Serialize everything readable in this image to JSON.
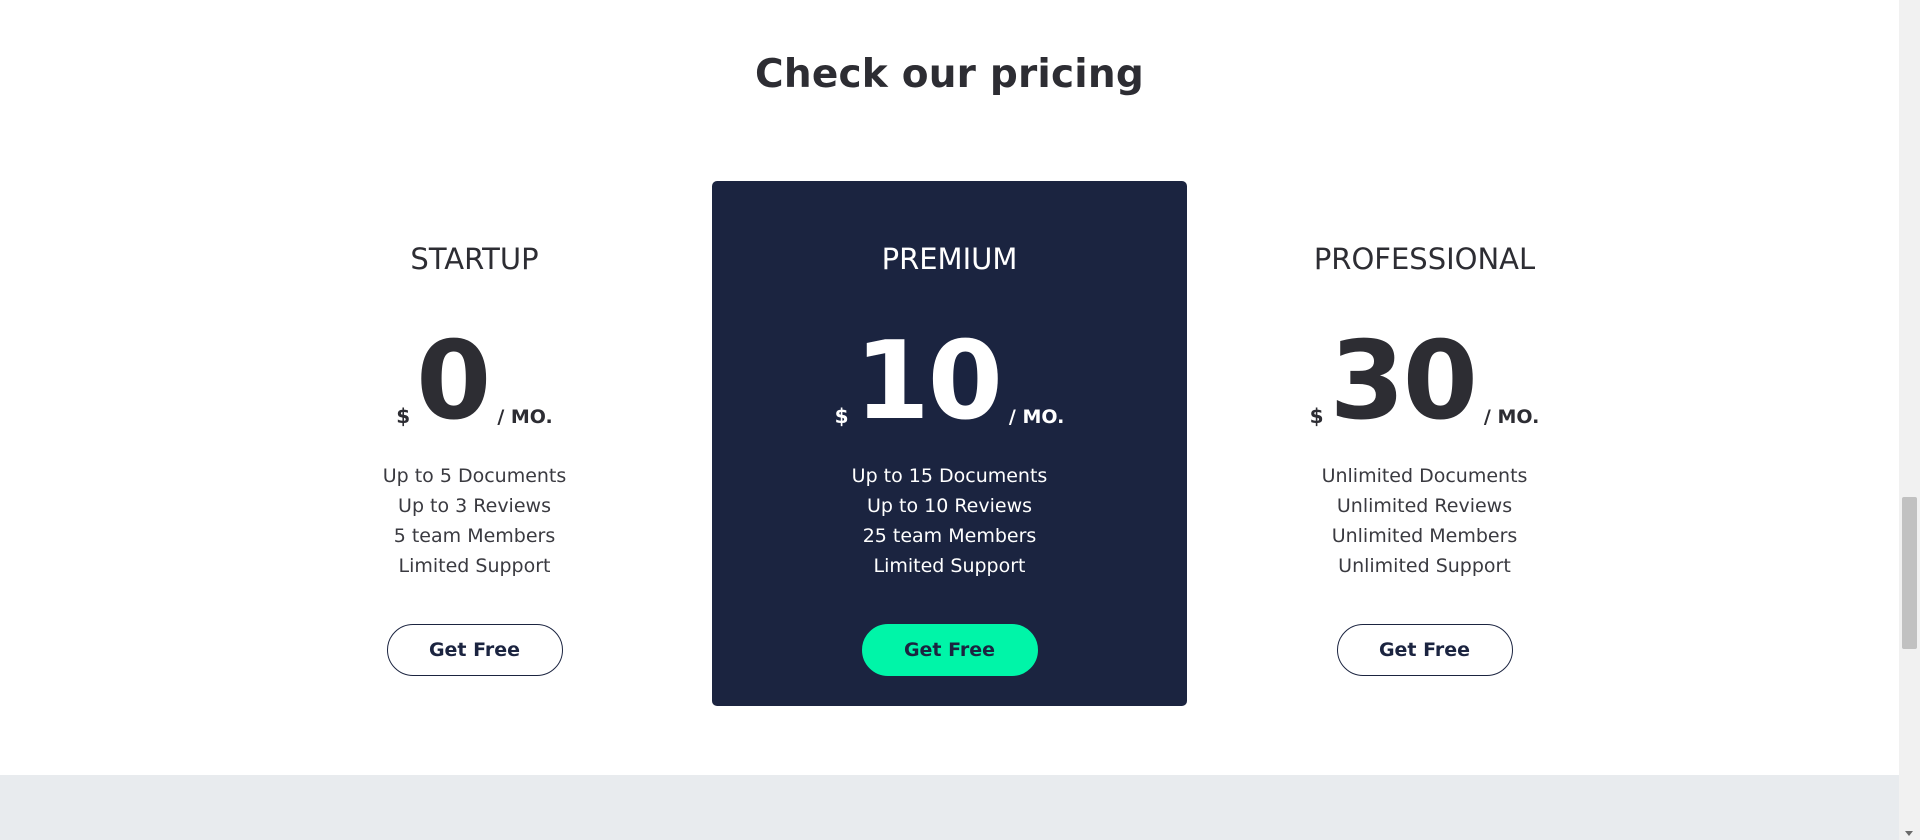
{
  "section": {
    "title": "Check our pricing"
  },
  "plans": [
    {
      "name": "STARTUP",
      "currency": "$",
      "amount": "0",
      "period": "/ MO.",
      "features": [
        "Up to 5 Documents",
        "Up to 3 Reviews",
        "5 team Members",
        "Limited Support"
      ],
      "cta": "Get Free"
    },
    {
      "name": "PREMIUM",
      "currency": "$",
      "amount": "10",
      "period": "/ MO.",
      "features": [
        "Up to 15 Documents",
        "Up to 10 Reviews",
        "25 team Members",
        "Limited Support"
      ],
      "cta": "Get Free"
    },
    {
      "name": "PROFESSIONAL",
      "currency": "$",
      "amount": "30",
      "period": "/ MO.",
      "features": [
        "Unlimited Documents",
        "Unlimited Reviews",
        "Unlimited Members",
        "Unlimited Support"
      ],
      "cta": "Get Free"
    }
  ],
  "colors": {
    "featured_bg": "#1b2440",
    "accent": "#00f5a8",
    "text": "#2d2d33",
    "footer_band": "#e8ebee"
  }
}
